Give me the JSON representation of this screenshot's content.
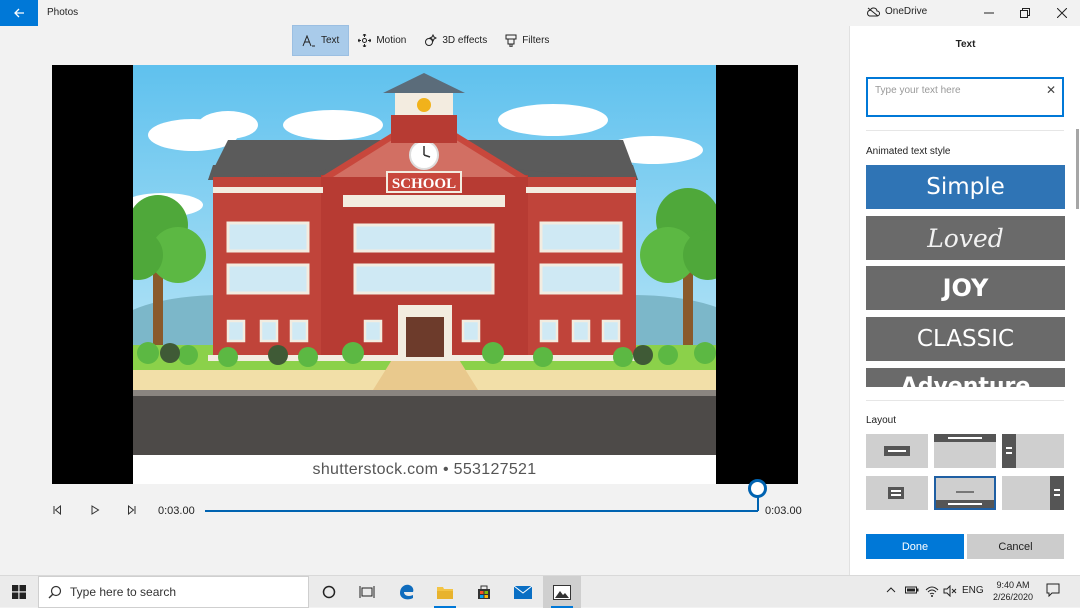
{
  "app": {
    "title": "Photos"
  },
  "titlebar": {
    "onedrive_label": "OneDrive"
  },
  "toolbar": {
    "items": [
      {
        "label": "Text",
        "icon": "text-icon",
        "active": true
      },
      {
        "label": "Motion",
        "icon": "motion-icon",
        "active": false
      },
      {
        "label": "3D effects",
        "icon": "3d-effects-icon",
        "active": false
      },
      {
        "label": "Filters",
        "icon": "filters-icon",
        "active": false
      }
    ]
  },
  "video": {
    "sign_text": "SCHOOL",
    "watermark": "shutterstock.com • 553127521"
  },
  "playback": {
    "current_time": "0:03.00",
    "end_time": "0:03.00",
    "progress_fraction": 1.0
  },
  "panel": {
    "title": "Text",
    "text_input": {
      "value": "",
      "placeholder": "Type your text here"
    },
    "animated_label": "Animated text style",
    "styles": [
      "Simple",
      "Loved",
      "JOY",
      "CLASSIC",
      "Adventure"
    ],
    "selected_style": "Simple",
    "layout_label": "Layout",
    "selected_layout_index": 4,
    "done_label": "Done",
    "cancel_label": "Cancel"
  },
  "taskbar": {
    "search_placeholder": "Type here to search",
    "language": "ENG",
    "time": "9:40 AM",
    "date": "2/26/2020"
  },
  "colors": {
    "accent": "#0078d7",
    "selected_style": "#2f74b5",
    "style_tile": "#6a6a6a",
    "toolbar_active": "#a9cbea"
  }
}
